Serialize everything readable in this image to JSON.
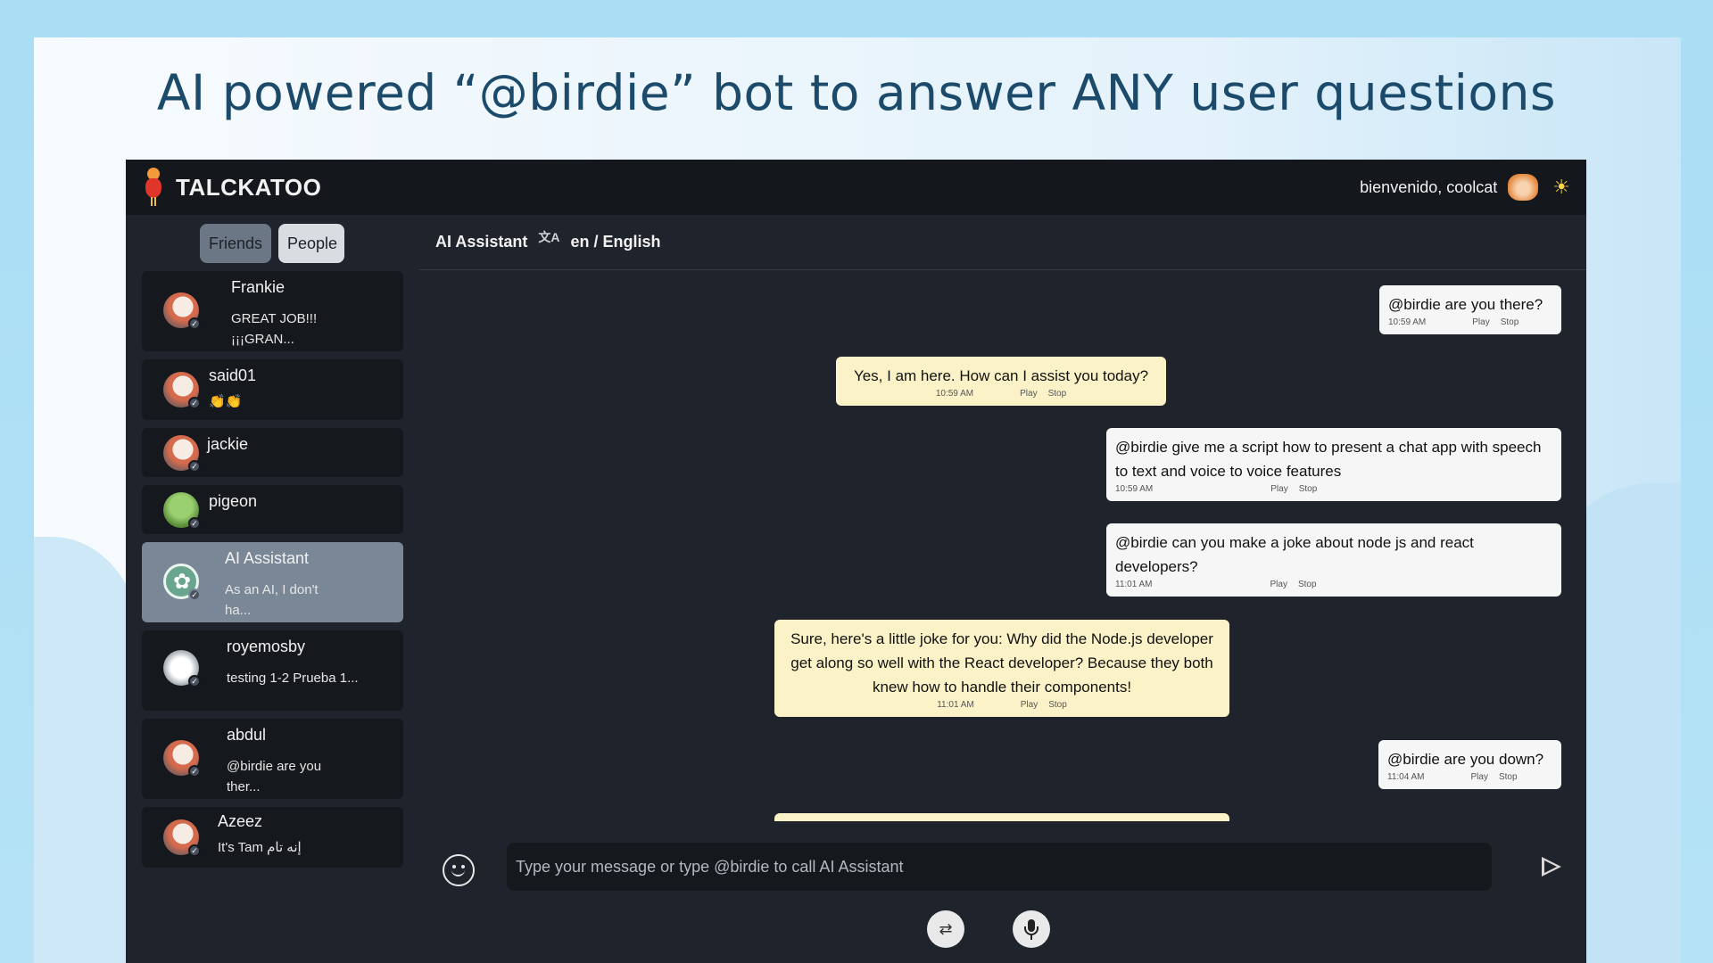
{
  "headline": "AI powered “@birdie” bot to answer ANY user questions",
  "app": {
    "brand": "TALCKATOO",
    "greeting": "bienvenido, coolcat",
    "icons": {
      "logo": "cockatoo-logo-icon",
      "avatar": "cat-avatar-icon",
      "theme": "sun-icon"
    }
  },
  "sidebar": {
    "tabs": {
      "friends": "Friends",
      "people": "People"
    },
    "contacts": [
      {
        "name": "Frankie",
        "preview": "GREAT JOB!!! ¡¡¡GRAN..."
      },
      {
        "name": "said01",
        "preview": "👏👏"
      },
      {
        "name": "jackie",
        "preview": ""
      },
      {
        "name": "pigeon",
        "preview": ""
      },
      {
        "name": "AI Assistant",
        "preview": "As an AI, I don't ha...",
        "active": true
      },
      {
        "name": "royemosby",
        "preview": "testing 1-2 Prueba 1..."
      },
      {
        "name": "abdul",
        "preview": "@birdie are you ther..."
      },
      {
        "name": "Azeez",
        "preview": "It's Tam إنه تام"
      }
    ]
  },
  "chat": {
    "header": {
      "name": "AI Assistant",
      "language": "en / English"
    },
    "controls": {
      "play": "Play",
      "stop": "Stop"
    },
    "messages": [
      {
        "from": "user",
        "text": "@birdie are you there?",
        "time": "10:59 AM"
      },
      {
        "from": "bot",
        "text": "Yes, I am here. How can I assist you today?",
        "time": "10:59 AM"
      },
      {
        "from": "user",
        "text": "@birdie give me a script how to present a chat app with speech to text and voice to voice features",
        "time": "10:59 AM"
      },
      {
        "from": "user",
        "text": "@birdie can you make a joke about node js and react developers?",
        "time": "11:01 AM"
      },
      {
        "from": "bot",
        "text": "Sure, here's a little joke for you: Why did the Node.js developer get along so well with the React developer? Because they both knew how to handle their components!",
        "time": "11:01 AM"
      },
      {
        "from": "user",
        "text": "@birdie are you down?",
        "time": "11:04 AM"
      }
    ],
    "input": {
      "placeholder": "Type your message or type @birdie to call AI Assistant",
      "value": ""
    }
  }
}
